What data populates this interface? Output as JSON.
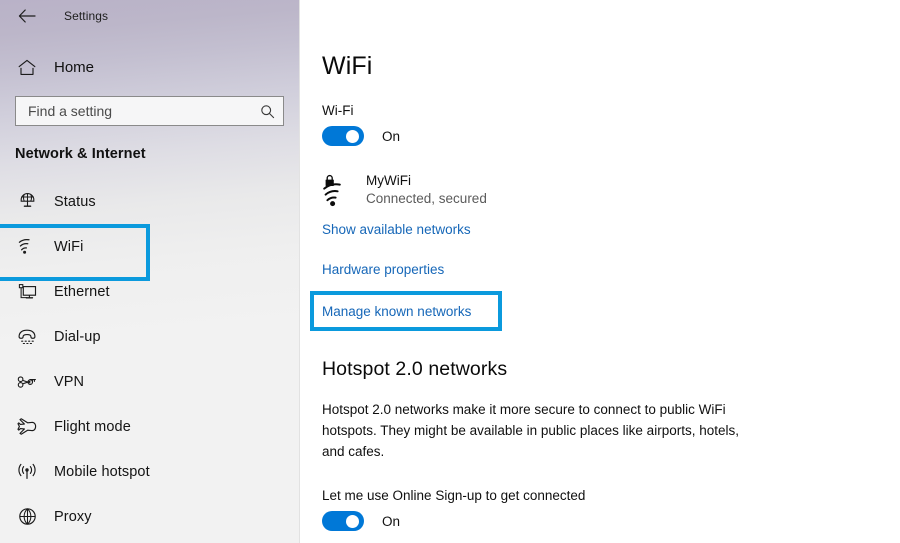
{
  "window": {
    "title": "Settings",
    "back_icon": "back-arrow-icon"
  },
  "sidebar": {
    "home": {
      "label": "Home",
      "icon": "home-icon"
    },
    "search": {
      "placeholder": "Find a setting",
      "value": "",
      "icon": "search-icon"
    },
    "category_title": "Network & Internet",
    "items": [
      {
        "label": "Status",
        "icon": "globe-status-icon",
        "selected": false
      },
      {
        "label": "WiFi",
        "icon": "wifi-icon",
        "selected": true
      },
      {
        "label": "Ethernet",
        "icon": "ethernet-monitor-icon",
        "selected": false
      },
      {
        "label": "Dial-up",
        "icon": "dialup-phone-icon",
        "selected": false
      },
      {
        "label": "VPN",
        "icon": "vpn-key-icon",
        "selected": false
      },
      {
        "label": "Flight mode",
        "icon": "airplane-icon",
        "selected": false
      },
      {
        "label": "Mobile hotspot",
        "icon": "broadcast-tower-icon",
        "selected": false
      },
      {
        "label": "Proxy",
        "icon": "globe-icon",
        "selected": false
      }
    ]
  },
  "main": {
    "page_title": "WiFi",
    "wifi_toggle": {
      "label": "Wi-Fi",
      "state": "On",
      "on": true
    },
    "connected_network": {
      "name": "MyWiFi",
      "status": "Connected, secured",
      "icon": "wifi-secured-lock-icon"
    },
    "links": [
      {
        "label": "Show available networks",
        "name": "show-available-networks-link"
      },
      {
        "label": "Hardware properties",
        "name": "hardware-properties-link"
      },
      {
        "label": "Manage known networks",
        "name": "manage-known-networks-link",
        "highlighted": true
      }
    ],
    "hotspot_section": {
      "heading": "Hotspot 2.0 networks",
      "description": "Hotspot 2.0 networks make it more secure to connect to public WiFi hotspots. They might be available in public places like airports, hotels, and cafes.",
      "signup_toggle": {
        "label": "Let me use Online Sign-up to get connected",
        "state": "On",
        "on": true
      }
    }
  },
  "colors": {
    "accent": "#0078d7",
    "callout_highlight": "#0b9add",
    "link": "#1667b8",
    "sidebar_bg": "#f2f2f2"
  }
}
